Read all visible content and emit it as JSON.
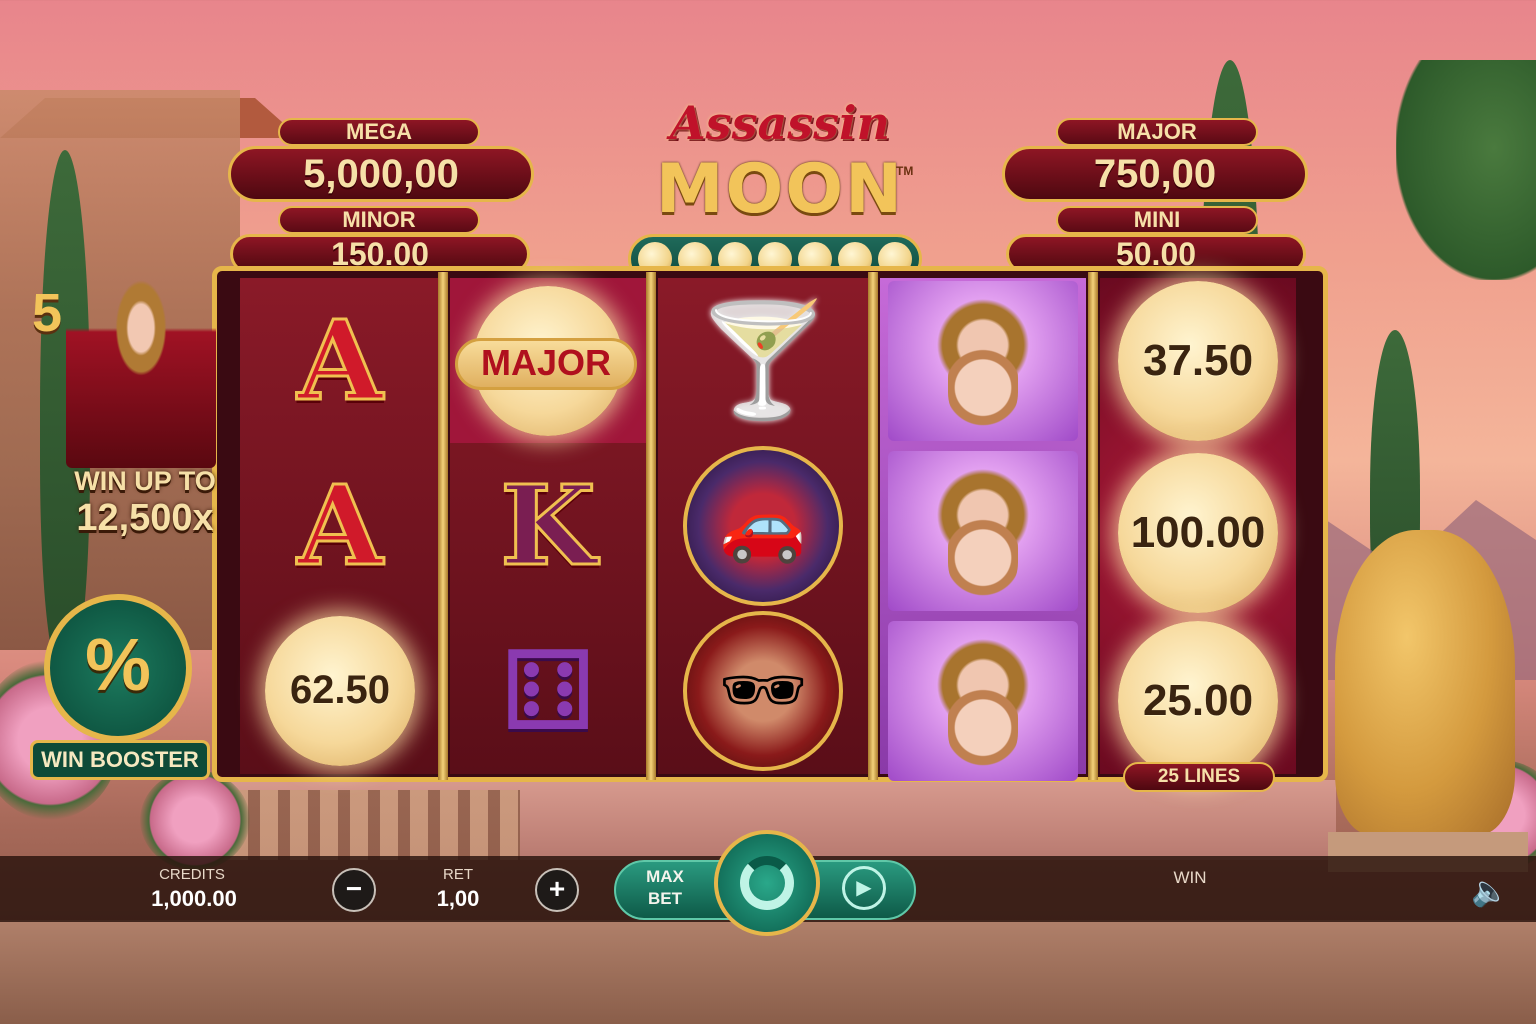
{
  "jackpots": {
    "mega": {
      "label": "MEGA",
      "value": "5,000,00"
    },
    "minor": {
      "label": "MINOR",
      "value": "150.00"
    },
    "major": {
      "label": "MAJOR",
      "value": "750,00"
    },
    "mini": {
      "label": "MINI",
      "value": "50.00"
    }
  },
  "logo": {
    "line1": "Assassin",
    "line2": "MOON",
    "tm": "TM"
  },
  "moon_collector": {
    "filled": 7,
    "total": 7
  },
  "reels": {
    "reel1": [
      "A",
      "A",
      "62.50"
    ],
    "reel2": [
      "MAJOR",
      "K",
      "dice"
    ],
    "reel3": [
      "martini",
      "sports-car",
      "assassin-man"
    ],
    "reel4": [
      "assassin-woman",
      "assassin-woman",
      "assassin-woman"
    ],
    "reel5": [
      "37.50",
      "100.00",
      "25.00"
    ]
  },
  "lines_badge": "25 LINES",
  "promo": {
    "free_count": "5",
    "win_up_line1": "WIN UP TO",
    "win_up_line2": "12,500x"
  },
  "booster": {
    "symbol": "%",
    "label": "WIN BOOSTER"
  },
  "bottom_bar": {
    "credits_label": "CREDITS",
    "credits_value": "1,000.00",
    "bet_label": "RET",
    "bet_value": "1,00",
    "minus": "−",
    "plus": "+",
    "max_bet": "MAX BET",
    "win_label": "WIN",
    "autoplay_icon": "▶",
    "sound_icon": "🔈"
  },
  "colors": {
    "gold": "#e6b64a",
    "crimson": "#8e1624",
    "teal": "#1c7a5e"
  }
}
